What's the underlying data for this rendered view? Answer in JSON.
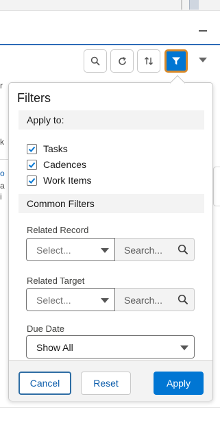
{
  "background": {
    "left_fragments": [
      "r",
      "k",
      "o",
      "a",
      "i"
    ]
  },
  "toolbar": {
    "buttons": [
      {
        "icon": "search-icon"
      },
      {
        "icon": "refresh-icon"
      },
      {
        "icon": "sort-icon"
      },
      {
        "icon": "filter-icon",
        "active": true
      }
    ],
    "menu_icon": "chevron-down-icon"
  },
  "filters": {
    "title": "Filters",
    "apply_to": {
      "heading": "Apply to:",
      "options": [
        {
          "label": "Tasks",
          "checked": true
        },
        {
          "label": "Cadences",
          "checked": true
        },
        {
          "label": "Work Items",
          "checked": true
        }
      ]
    },
    "common": {
      "heading": "Common Filters",
      "related_record": {
        "label": "Related Record",
        "select_placeholder": "Select...",
        "search_placeholder": "Search..."
      },
      "related_target": {
        "label": "Related Target",
        "select_placeholder": "Select...",
        "search_placeholder": "Search..."
      },
      "due_date": {
        "label": "Due Date",
        "value": "Show All"
      }
    },
    "footer": {
      "cancel_label": "Cancel",
      "reset_label": "Reset",
      "apply_label": "Apply"
    }
  },
  "colors": {
    "brand_blue": "#0176d3",
    "focus_ring": "#d98a2b",
    "section_bg": "#f3f3f3"
  }
}
